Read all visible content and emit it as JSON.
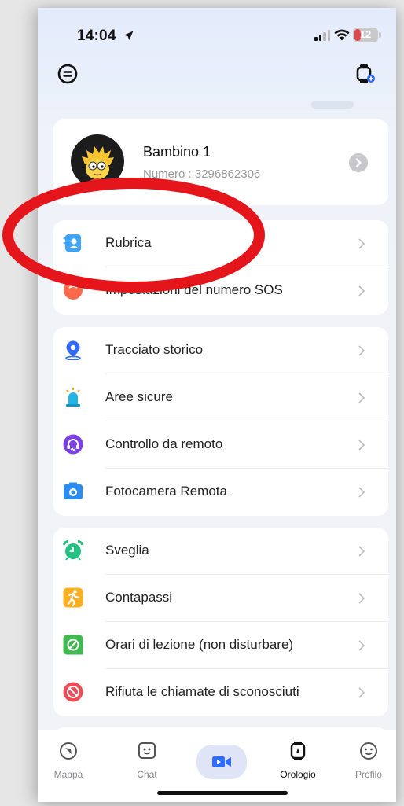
{
  "status_bar": {
    "time": "14:04",
    "battery": "12"
  },
  "profile": {
    "name": "Bambino 1",
    "number": "Numero : 3296862306"
  },
  "group1": [
    {
      "label": "Rubrica",
      "icon": "contacts-icon"
    },
    {
      "label": "Impostazioni del numero SOS",
      "icon": "sos-icon"
    }
  ],
  "group2": [
    {
      "label": "Tracciato storico",
      "icon": "location-pin-icon"
    },
    {
      "label": "Aree sicure",
      "icon": "safe-zone-icon"
    },
    {
      "label": "Controllo da remoto",
      "icon": "remote-listen-icon"
    },
    {
      "label": "Fotocamera Remota",
      "icon": "camera-icon"
    }
  ],
  "group3": [
    {
      "label": "Sveglia",
      "icon": "alarm-clock-icon"
    },
    {
      "label": "Contapassi",
      "icon": "pedometer-icon"
    },
    {
      "label": "Orari di lezione (non disturbare)",
      "icon": "do-not-disturb-icon"
    },
    {
      "label": "Rifiuta le chiamate di sconosciuti",
      "icon": "block-calls-icon"
    }
  ],
  "tabs": [
    {
      "label": "Mappa",
      "icon": "map-compass-icon"
    },
    {
      "label": "Chat",
      "icon": "chat-icon"
    },
    {
      "label": "",
      "icon": "video-call-icon"
    },
    {
      "label": "Orologio",
      "icon": "watch-icon",
      "active": true
    },
    {
      "label": "Profilo",
      "icon": "smiley-icon"
    }
  ],
  "colors": {
    "accent_blue": "#2f6bff",
    "annotation_red": "#e5161b",
    "icon_green": "#26c281",
    "icon_orange": "#ffb020",
    "icon_purple": "#7b3fe4",
    "icon_red": "#f04b55"
  }
}
